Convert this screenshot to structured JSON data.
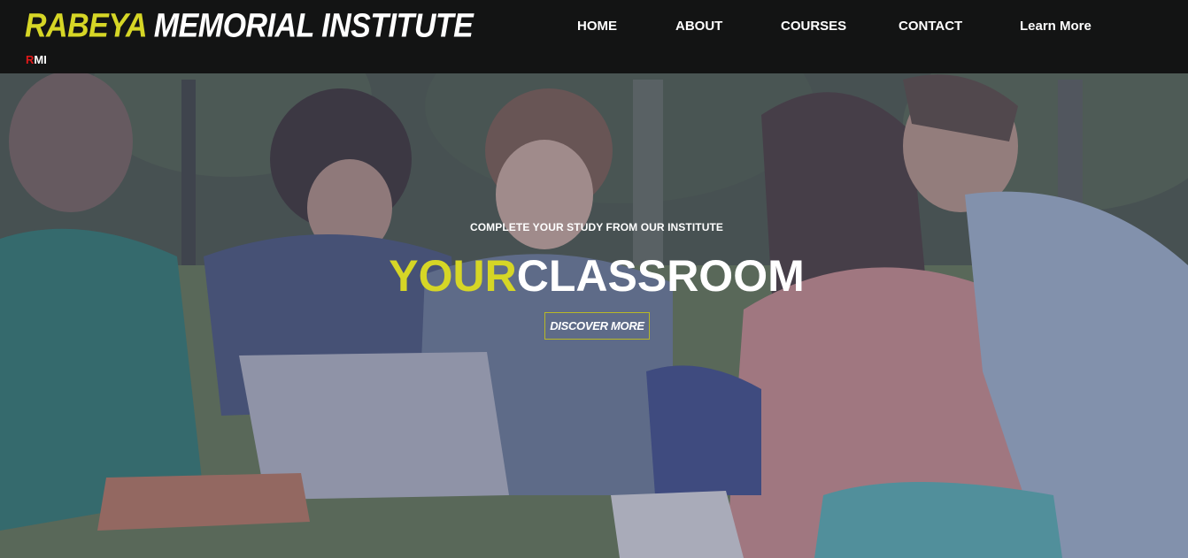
{
  "header": {
    "brand_first": "RABEYA",
    "brand_rest": " MEMORIAL INSTITUTE",
    "abbr_first": "R",
    "abbr_rest": "MI",
    "nav": [
      {
        "label": "HOME"
      },
      {
        "label": "ABOUT"
      },
      {
        "label": "COURSES"
      },
      {
        "label": "CONTACT"
      },
      {
        "label": "Learn More"
      }
    ]
  },
  "hero": {
    "subtitle": "COMPLETE YOUR STUDY FROM OUR INSTITUTE",
    "title_accent": "YOUR",
    "title_rest": "CLASSROOM",
    "cta_label": "DISCOVER MORE"
  },
  "colors": {
    "accent": "#d6d626",
    "nav_bg": "#0f0f0f",
    "abbr_red": "#e01919",
    "text": "#ffffff"
  }
}
